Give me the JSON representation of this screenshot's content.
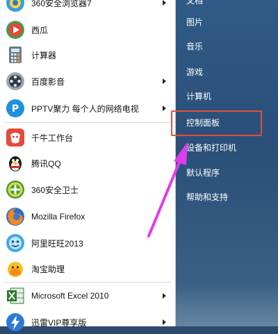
{
  "colors": {
    "accent_arrow": "#e13bec",
    "highlight_box": "#e74c3c",
    "right_panel": "#2f5b86"
  },
  "programs": [
    {
      "label": "360安全浏览器7",
      "icon": "360-browser-icon",
      "has_submenu": true
    },
    {
      "label": "西瓜",
      "icon": "xigua-icon",
      "has_submenu": false
    },
    {
      "label": "计算器",
      "icon": "calculator-icon",
      "has_submenu": false
    },
    {
      "label": "百度影音",
      "icon": "baidu-player-icon",
      "has_submenu": true
    },
    {
      "label": "PPTV聚力 每个人的网络电视",
      "icon": "pptv-icon",
      "has_submenu": true
    },
    {
      "label": "千牛工作台",
      "icon": "qianniu-icon",
      "has_submenu": false
    },
    {
      "label": "腾讯QQ",
      "icon": "qq-penguin-icon",
      "has_submenu": false
    },
    {
      "label": "360安全卫士",
      "icon": "360-safeguard-icon",
      "has_submenu": false
    },
    {
      "label": "Mozilla Firefox",
      "icon": "firefox-icon",
      "has_submenu": false
    },
    {
      "label": "阿里旺旺2013",
      "icon": "aliwangwang-icon",
      "has_submenu": false
    },
    {
      "label": "淘宝助理",
      "icon": "taobao-assistant-icon",
      "has_submenu": false
    },
    {
      "label": "Microsoft Excel 2010",
      "icon": "excel-icon",
      "has_submenu": true
    },
    {
      "label": "迅雷VIP尊享版",
      "icon": "xunlei-icon",
      "has_submenu": true
    }
  ],
  "right_items": [
    {
      "label": "文档"
    },
    {
      "label": "图片"
    },
    {
      "label": "音乐"
    },
    {
      "label": "游戏"
    },
    {
      "label": "计算机"
    },
    {
      "label": "控制面板"
    },
    {
      "label": "设备和打印机"
    },
    {
      "label": "默认程序"
    },
    {
      "label": "帮助和支持"
    }
  ]
}
